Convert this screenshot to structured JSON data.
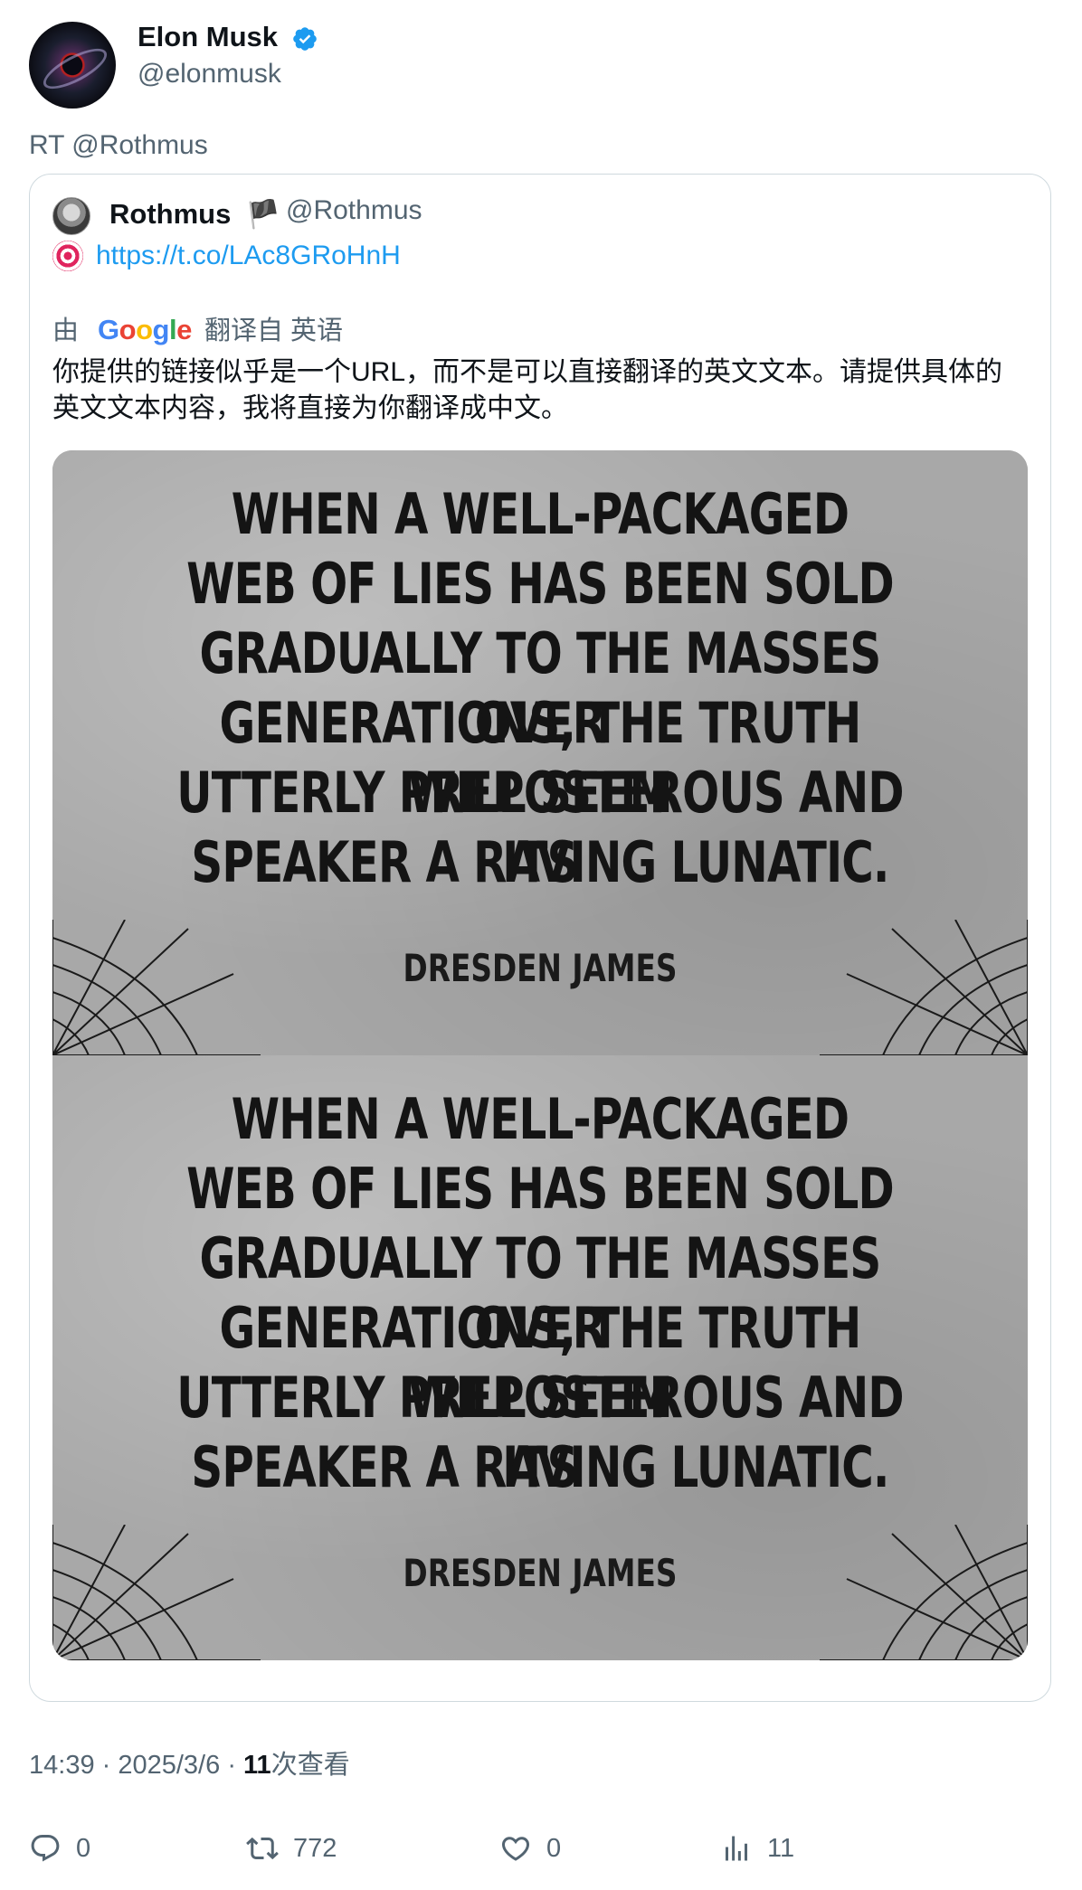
{
  "author": {
    "name": "Elon Musk",
    "handle": "@elonmusk",
    "verified": true,
    "avatar_icon": "black-hole-avatar"
  },
  "retweet_text": "RT @Rothmus",
  "quoted": {
    "name": "Rothmus",
    "flag": "🏴",
    "handle": "@Rothmus",
    "target_icon": "direct-hit-emoji",
    "link": "https://t.co/LAc8GRoHnH",
    "translation": {
      "by_label": "由",
      "provider": "Google",
      "from_label": "翻译自 英语",
      "text": "你提供的链接似乎是一个URL，而不是可以直接翻译的英文文本。请提供具体的英文文本内容，我将直接为你翻译成中文。"
    },
    "image": {
      "lines": [
        "WHEN A WELL-PACKAGED",
        "WEB OF LIES HAS BEEN SOLD",
        "GRADUALLY TO THE MASSES OVER",
        "GENERATIONS, THE TRUTH WILL SEEM",
        "UTTERLY PREPOSTEROUS AND ITS",
        "SPEAKER A RAVING LUNATIC."
      ],
      "author": "DRESDEN JAMES"
    }
  },
  "meta": {
    "time": "14:39",
    "date": "2025/3/6",
    "views_count": "11",
    "views_label": "次查看"
  },
  "actions": {
    "replies": "0",
    "retweets": "772",
    "likes": "0",
    "views": "11"
  },
  "colors": {
    "link": "#1d9bf0",
    "secondary_text": "#536471",
    "verified": "#1d9bf0"
  }
}
